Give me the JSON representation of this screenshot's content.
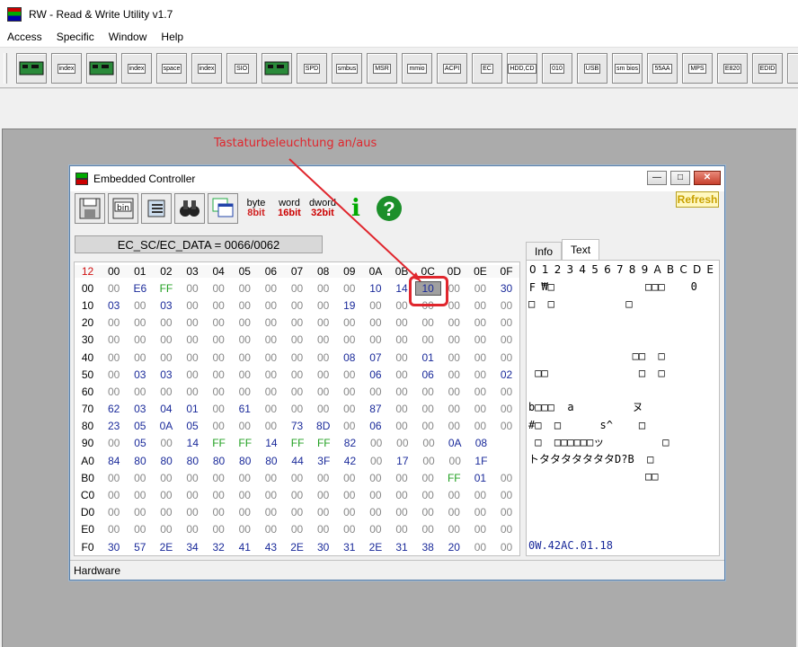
{
  "app": {
    "title": "RW - Read & Write Utility v1.7"
  },
  "menu": [
    "Access",
    "Specific",
    "Window",
    "Help"
  ],
  "toolbar": [
    {
      "icon": "pci-card-icon",
      "label": ""
    },
    {
      "icon": "pci-index-icon",
      "label": "index"
    },
    {
      "icon": "memory-icon",
      "label": ""
    },
    {
      "icon": "memory-index-icon",
      "label": "index"
    },
    {
      "icon": "io-space-icon",
      "label": "space"
    },
    {
      "icon": "io-index-icon",
      "label": "index"
    },
    {
      "icon": "sio-icon",
      "label": "SIO"
    },
    {
      "icon": "oscilloscope-icon",
      "label": ""
    },
    {
      "icon": "spd-icon",
      "label": "SPD"
    },
    {
      "icon": "smbus-icon",
      "label": "smbus"
    },
    {
      "icon": "msr-icon",
      "label": "MSR"
    },
    {
      "icon": "mmio-icon",
      "label": "mmio"
    },
    {
      "icon": "acpi-icon",
      "label": "ACPI"
    },
    {
      "icon": "ec-icon",
      "label": "EC"
    },
    {
      "icon": "hdd-cd-icon",
      "label": "HDD,CD"
    },
    {
      "icon": "binary-icon",
      "label": "010"
    },
    {
      "icon": "usb-icon",
      "label": "USB"
    },
    {
      "icon": "smbios-icon",
      "label": "sm bios"
    },
    {
      "icon": "55aa-icon",
      "label": "55AA"
    },
    {
      "icon": "mps-icon",
      "label": "MPS"
    },
    {
      "icon": "e820-icon",
      "label": "E820"
    },
    {
      "icon": "edid-icon",
      "label": "EDID"
    },
    {
      "icon": "command-icon",
      "label": ">"
    }
  ],
  "annotation": "Tastaturbeleuchtung an/aus",
  "ec_window": {
    "title": "Embedded Controller",
    "tools": {
      "byte": "byte",
      "byte_bits": "8bit",
      "word": "word",
      "word_bits": "16bit",
      "dword": "dword",
      "dword_bits": "32bit"
    },
    "refresh_label": "Refresh",
    "address_label": "EC_SC/EC_DATA = 0066/0062",
    "grid": {
      "corner": "12",
      "columns": [
        "00",
        "01",
        "02",
        "03",
        "04",
        "05",
        "06",
        "07",
        "08",
        "09",
        "0A",
        "0B",
        "0C",
        "0D",
        "0E",
        "0F"
      ],
      "rows": [
        {
          "addr": "00",
          "vals": [
            "00",
            "E6",
            "FF",
            "00",
            "00",
            "00",
            "00",
            "00",
            "00",
            "00",
            "10",
            "14",
            "10",
            "00",
            "00",
            "30"
          ]
        },
        {
          "addr": "10",
          "vals": [
            "03",
            "00",
            "03",
            "00",
            "00",
            "00",
            "00",
            "00",
            "00",
            "19",
            "00",
            "00",
            "00",
            "00",
            "00",
            "00"
          ]
        },
        {
          "addr": "20",
          "vals": [
            "00",
            "00",
            "00",
            "00",
            "00",
            "00",
            "00",
            "00",
            "00",
            "00",
            "00",
            "00",
            "00",
            "00",
            "00",
            "00"
          ]
        },
        {
          "addr": "30",
          "vals": [
            "00",
            "00",
            "00",
            "00",
            "00",
            "00",
            "00",
            "00",
            "00",
            "00",
            "00",
            "00",
            "00",
            "00",
            "00",
            "00"
          ]
        },
        {
          "addr": "40",
          "vals": [
            "00",
            "00",
            "00",
            "00",
            "00",
            "00",
            "00",
            "00",
            "00",
            "08",
            "07",
            "00",
            "01",
            "00",
            "00",
            "00"
          ]
        },
        {
          "addr": "50",
          "vals": [
            "00",
            "03",
            "03",
            "00",
            "00",
            "00",
            "00",
            "00",
            "00",
            "00",
            "06",
            "00",
            "06",
            "00",
            "00",
            "02"
          ]
        },
        {
          "addr": "60",
          "vals": [
            "00",
            "00",
            "00",
            "00",
            "00",
            "00",
            "00",
            "00",
            "00",
            "00",
            "00",
            "00",
            "00",
            "00",
            "00",
            "00"
          ]
        },
        {
          "addr": "70",
          "vals": [
            "62",
            "03",
            "04",
            "01",
            "00",
            "61",
            "00",
            "00",
            "00",
            "00",
            "87",
            "00",
            "00",
            "00",
            "00",
            "00"
          ]
        },
        {
          "addr": "80",
          "vals": [
            "23",
            "05",
            "0A",
            "05",
            "00",
            "00",
            "00",
            "73",
            "8D",
            "00",
            "06",
            "00",
            "00",
            "00",
            "00",
            "00"
          ]
        },
        {
          "addr": "90",
          "vals": [
            "00",
            "05",
            "00",
            "14",
            "FF",
            "FF",
            "14",
            "FF",
            "FF",
            "82",
            "00",
            "00",
            "00",
            "0A",
            "08"
          ]
        },
        {
          "addr": "A0",
          "vals": [
            "84",
            "80",
            "80",
            "80",
            "80",
            "80",
            "80",
            "44",
            "3F",
            "42",
            "00",
            "17",
            "00",
            "00",
            "1F"
          ]
        },
        {
          "addr": "B0",
          "vals": [
            "00",
            "00",
            "00",
            "00",
            "00",
            "00",
            "00",
            "00",
            "00",
            "00",
            "00",
            "00",
            "00",
            "FF",
            "01",
            "00"
          ]
        },
        {
          "addr": "C0",
          "vals": [
            "00",
            "00",
            "00",
            "00",
            "00",
            "00",
            "00",
            "00",
            "00",
            "00",
            "00",
            "00",
            "00",
            "00",
            "00",
            "00"
          ]
        },
        {
          "addr": "D0",
          "vals": [
            "00",
            "00",
            "00",
            "00",
            "00",
            "00",
            "00",
            "00",
            "00",
            "00",
            "00",
            "00",
            "00",
            "00",
            "00",
            "00"
          ]
        },
        {
          "addr": "E0",
          "vals": [
            "00",
            "00",
            "00",
            "00",
            "00",
            "00",
            "00",
            "00",
            "00",
            "00",
            "00",
            "00",
            "00",
            "00",
            "00",
            "00"
          ]
        },
        {
          "addr": "F0",
          "vals": [
            "30",
            "57",
            "2E",
            "34",
            "32",
            "41",
            "43",
            "2E",
            "30",
            "31",
            "2E",
            "31",
            "38",
            "20",
            "00",
            "00"
          ]
        }
      ]
    },
    "tabs": [
      "Info",
      "Text"
    ],
    "active_tab": "Text",
    "text_header": "0 1 2 3 4 5 6 7 8 9 A B C D E F",
    "text_lines": [
      "  ₩□              □□□    0",
      "□  □           □",
      "",
      "",
      "                □□  □",
      " □□              □  □",
      "",
      "b□□□  a         ヌ",
      "#□  □      s^    □",
      " □  □□□□□□ッ         □",
      "トタタタタタタタD?B  □",
      "                  □□",
      "",
      "",
      "",
      "0W.42AC.01.18"
    ],
    "status": "Hardware"
  }
}
